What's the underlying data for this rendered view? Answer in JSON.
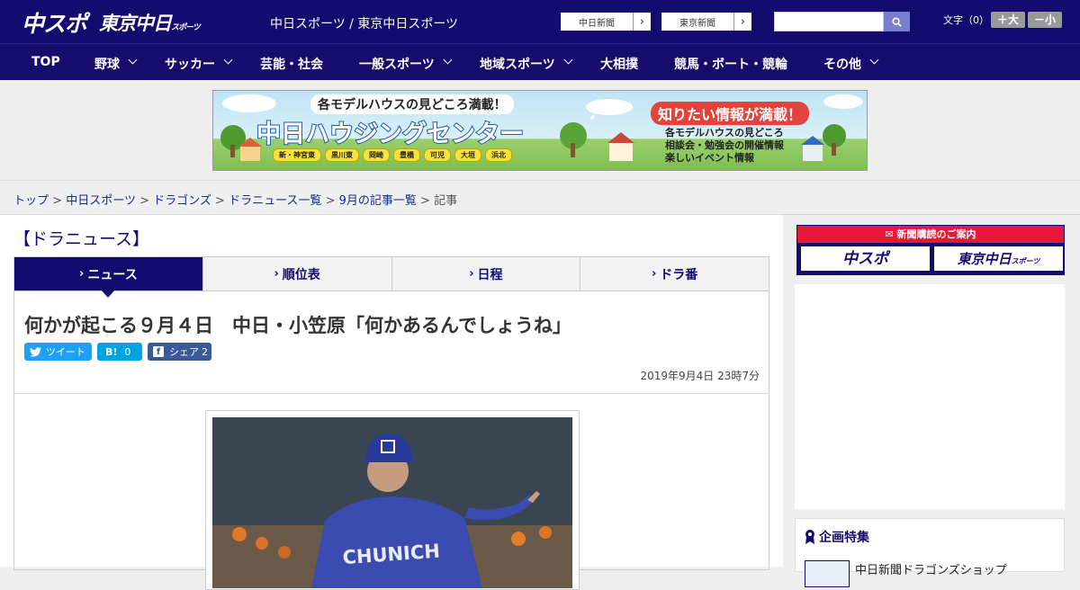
{
  "header": {
    "logo_chuspo": "中スポ",
    "logo_tokyo": "東京中日",
    "logo_tokyo_small": "スポーツ",
    "site_title": "中日スポーツ / 東京中日スポーツ",
    "paper_links": [
      "中日新聞",
      "東京新聞"
    ],
    "search": {
      "placeholder": "",
      "value": ""
    },
    "font_size_label": "文字（0）",
    "font_larger": "＋大",
    "font_smaller": "－小"
  },
  "nav": {
    "items": [
      {
        "label": "TOP",
        "dropdown": false
      },
      {
        "label": "野球",
        "dropdown": true
      },
      {
        "label": "サッカー",
        "dropdown": true
      },
      {
        "label": "芸能・社会",
        "dropdown": false
      },
      {
        "label": "一般スポーツ",
        "dropdown": true
      },
      {
        "label": "地域スポーツ",
        "dropdown": true
      },
      {
        "label": "大相撲",
        "dropdown": false
      },
      {
        "label": "競馬・ボート・競輪",
        "dropdown": false
      },
      {
        "label": "その他",
        "dropdown": true
      }
    ]
  },
  "banner": {
    "subtitle": "各モデルハウスの見どころ満載！",
    "title": "中日ハウジングセンター",
    "cities": [
      "新・神宮東",
      "黒川東",
      "岡崎",
      "豊橋",
      "可児",
      "大垣",
      "浜北"
    ],
    "right_headline": "知りたい情報が満載！",
    "right_lines": [
      "各モデルハウスの見どころ",
      "相談会・勉強会の開催情報",
      "楽しいイベント情報"
    ]
  },
  "breadcrumb": {
    "links": [
      "トップ",
      "中日スポーツ",
      "ドラゴンズ",
      "ドラニュース一覧",
      "9月の記事一覧"
    ],
    "separator": ">",
    "current": "記事"
  },
  "section": {
    "title": "【ドラニュース】"
  },
  "tabs": [
    {
      "label": "ニュース",
      "active": true
    },
    {
      "label": "順位表",
      "active": false
    },
    {
      "label": "日程",
      "active": false
    },
    {
      "label": "ドラ番",
      "active": false
    }
  ],
  "article": {
    "headline": "何かが起こる９月４日　中日・小笠原「何かあるんでしょうね」",
    "tweet_label": "ツイート",
    "hatena_label": "B!",
    "hatena_count": "0",
    "share_label": "シェア",
    "share_count": "2",
    "date": "2019年9月4日 23時7分",
    "photo_jersey_text": "CHUNICH"
  },
  "sidebar": {
    "subscribe_header": "新聞購読のご案内",
    "subscribe_logos": [
      "中スポ",
      "東京中日"
    ],
    "subscribe_logo_small": "スポーツ",
    "feature_title": "企画特集",
    "feature_item": "中日新聞ドラゴンズショップ"
  },
  "colors": {
    "navy": "#140b6e",
    "red": "#e8163c",
    "twitter": "#1da1f2",
    "hatena": "#00a4de",
    "facebook": "#3b5998"
  }
}
